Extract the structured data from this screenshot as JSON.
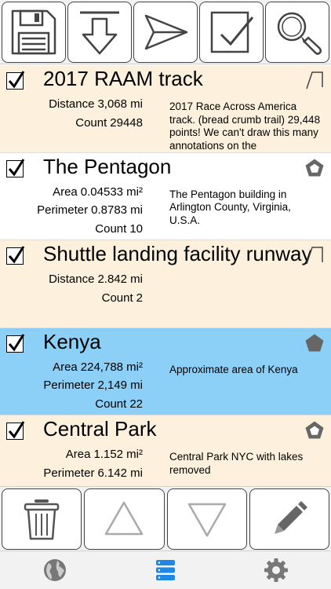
{
  "toolbar": {
    "buttons": [
      {
        "icon": "save-icon"
      },
      {
        "icon": "import-icon"
      },
      {
        "icon": "send-icon"
      },
      {
        "icon": "select-all-icon"
      },
      {
        "icon": "search-icon"
      }
    ]
  },
  "items": [
    {
      "title": "2017 RAAM track",
      "checked": true,
      "type_icon": "path-icon",
      "stats": [
        {
          "label": "Distance",
          "value": "3,068 mi"
        },
        {
          "label": "Count",
          "value": "29448"
        }
      ],
      "description": "2017 Race Across America track. (bread crumb trail) 29,448 points! We can't draw this many annotations on the"
    },
    {
      "title": "The Pentagon",
      "checked": true,
      "type_icon": "polygon-icon",
      "stats": [
        {
          "label": "Area",
          "value": "0.04533 mi²"
        },
        {
          "label": "Perimeter",
          "value": "0.8783 mi"
        },
        {
          "label": "Count",
          "value": "10"
        }
      ],
      "description": "The Pentagon building in Arlington County, Virginia, U.S.A."
    },
    {
      "title": "Shuttle landing facility runway",
      "checked": true,
      "type_icon": "path-icon",
      "stats": [
        {
          "label": "Distance",
          "value": "2.842 mi"
        },
        {
          "label": "Count",
          "value": "2"
        }
      ],
      "description": ""
    },
    {
      "title": "Kenya",
      "checked": true,
      "type_icon": "polygon-icon",
      "stats": [
        {
          "label": "Area",
          "value": "224,788 mi²"
        },
        {
          "label": "Perimeter",
          "value": "2,149 mi"
        },
        {
          "label": "Count",
          "value": "22"
        }
      ],
      "description": "Approximate area of Kenya"
    },
    {
      "title": "Central Park",
      "checked": true,
      "type_icon": "polygon-icon",
      "stats": [
        {
          "label": "Area",
          "value": "1.152 mi²"
        },
        {
          "label": "Perimeter",
          "value": "6.142 mi"
        }
      ],
      "description": "Central Park NYC with lakes removed"
    }
  ],
  "actions": [
    {
      "icon": "trash-icon"
    },
    {
      "icon": "move-up-icon"
    },
    {
      "icon": "move-down-icon"
    },
    {
      "icon": "edit-pencil-icon"
    }
  ],
  "tabbar": {
    "tabs": [
      {
        "icon": "globe-icon",
        "active": false
      },
      {
        "icon": "database-icon",
        "active": true
      },
      {
        "icon": "gear-icon",
        "active": false
      }
    ],
    "active_color": "#1e88e5"
  },
  "colors": {
    "row_peach": "#fdf1dd",
    "row_selected": "#8ccff7",
    "row_white": "#ffffff"
  }
}
